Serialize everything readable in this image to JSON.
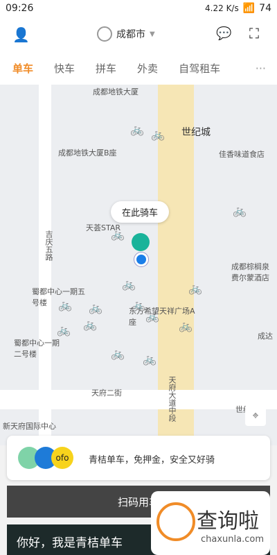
{
  "status": {
    "time": "09:26",
    "speed": "4.22 K/s",
    "battery": "74"
  },
  "header": {
    "city": "成都市"
  },
  "tabs": [
    "单车",
    "快车",
    "拼车",
    "外卖",
    "自驾租车"
  ],
  "more_label": "···",
  "map": {
    "labels": [
      "成都地铁大厦",
      "世纪城",
      "佳香味道食店",
      "成都地铁大厦B座",
      "天荟STAR",
      "吉庆五路",
      "成都棕榈泉费尔蒙酒店",
      "蜀都中心一期五号楼",
      "蜀都中心一期二号楼",
      "东方希望天祥广场A座",
      "天府二街",
      "天府大道中段",
      "新天府国际中心",
      "世纪城",
      "成达"
    ],
    "ride_here": "在此骑车"
  },
  "card": {
    "text": "青桔单车，免押金，安全又好骑",
    "logo_text": "ofo"
  },
  "scan": {
    "label": "扫码用车"
  },
  "banner": {
    "text": "你好，我是青桔单车"
  },
  "watermark": {
    "text": "查询啦",
    "url": "chaxunla.com"
  }
}
